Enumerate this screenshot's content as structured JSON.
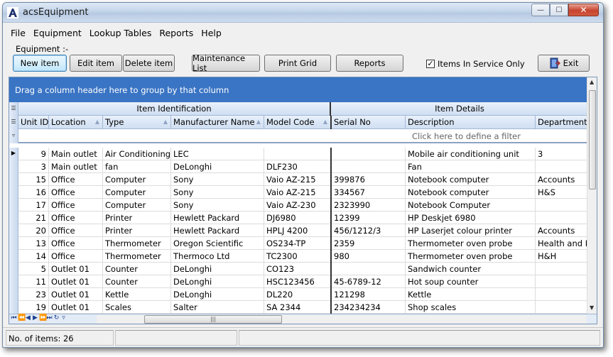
{
  "window": {
    "title": "acsEquipment"
  },
  "menu": [
    "File",
    "Equipment",
    "Lookup Tables",
    "Reports",
    "Help"
  ],
  "toolbar": {
    "group_label": "Equipment :-",
    "new_item": "New item",
    "edit_item": "Edit item",
    "delete_item": "Delete item",
    "maintenance_list": "Maintenance List",
    "print_grid": "Print Grid",
    "reports": "Reports",
    "in_service_only": "Items In Service Only",
    "in_service_checked": true,
    "exit": "Exit"
  },
  "grid": {
    "group_panel_text": "Drag a column header here to group by that column",
    "bands": [
      "Item Identification",
      "Item Details"
    ],
    "columns": [
      "Unit ID",
      "Location",
      "Type",
      "Manufacturer Name",
      "Model Code",
      "Serial No",
      "Description",
      "Department"
    ],
    "filter_prompt": "Click here to define a filter",
    "rows": [
      [
        "9",
        "Main outlet",
        "Air Conditioning",
        "LEC",
        "",
        "",
        "Mobile air conditioning unit",
        "3"
      ],
      [
        "3",
        "Main outlet",
        "fan",
        "DeLonghi",
        "DLF230",
        "",
        "Fan",
        ""
      ],
      [
        "15",
        "Office",
        "Computer",
        "Sony",
        "Vaio AZ-215",
        "399876",
        "Notebook computer",
        "Accounts"
      ],
      [
        "16",
        "Office",
        "Computer",
        "Sony",
        "Vaio AZ-215",
        "334567",
        "Notebook computer",
        "H&S"
      ],
      [
        "17",
        "Office",
        "Computer",
        "Sony",
        "Vaio AZ-230",
        "2323990",
        "Notebook Computer",
        ""
      ],
      [
        "21",
        "Office",
        "Printer",
        "Hewlett Packard",
        "DJ6980",
        "12399",
        "HP Deskjet 6980",
        ""
      ],
      [
        "20",
        "Office",
        "Printer",
        "Hewlett Packard",
        "HPLJ 4200",
        "456/1212/3",
        "HP Laserjet colour printer",
        "Accounts"
      ],
      [
        "13",
        "Office",
        "Thermometer",
        "Oregon Scientific",
        "OS234-TP",
        "2359",
        "Thermometer oven probe",
        "Health and Hyg"
      ],
      [
        "14",
        "Office",
        "Thermometer",
        "Thermoco Ltd",
        "TC2300",
        "980",
        "Thermometer oven probe",
        "H&H"
      ],
      [
        "5",
        "Outlet 01",
        "Counter",
        "DeLonghi",
        "CO123",
        "",
        "Sandwich counter",
        ""
      ],
      [
        "11",
        "Outlet 01",
        "Counter",
        "DeLonghi",
        "HSC123456",
        "45-6789-12",
        "Hot soup counter",
        ""
      ],
      [
        "23",
        "Outlet 01",
        "Kettle",
        "DeLonghi",
        "DL220",
        "121298",
        "Kettle",
        ""
      ],
      [
        "19",
        "Outlet 01",
        "Scales",
        "Salter",
        "SA 2344",
        "234234234",
        "Shop scales",
        ""
      ]
    ]
  },
  "status": {
    "items_count": "No. of items: 26"
  },
  "colors": {
    "group_panel": "#3a74c4",
    "header_bg": "#cfdff2"
  }
}
